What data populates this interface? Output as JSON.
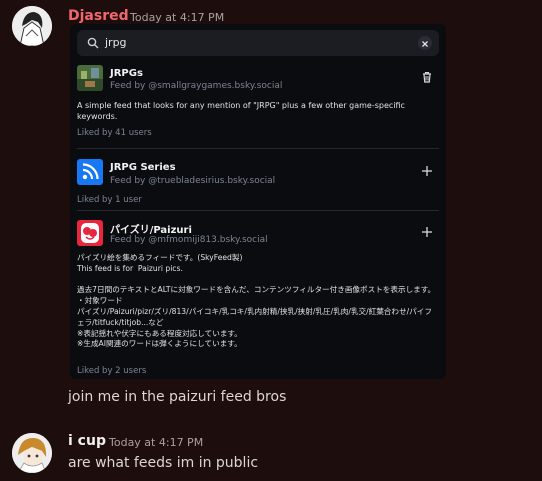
{
  "messages": [
    {
      "username": "Djasred",
      "username_color": "#f0676d",
      "timestamp": "Today at 4:17 PM",
      "embed": {
        "search": {
          "value": "jrpg"
        },
        "feeds": [
          {
            "title": "JRPGs",
            "by": "Feed by @smallgraygames.bsky.social",
            "description": "A simple feed that looks for any mention of \"JRPG\" plus a few other game-specific keywords.",
            "liked": "Liked by 41 users",
            "action_icon": "trash-icon"
          },
          {
            "title": "JRPG Series",
            "by": "Feed by @truebladesirius.bsky.social",
            "description": "",
            "liked": "Liked by 1 user",
            "action_icon": "plus-icon"
          },
          {
            "title": "パイズリ/Paizuri",
            "by": "Feed by @mfmomiji813.bsky.social",
            "description": "パイズリ絵を集めるフィードです。(SkyFeed製)\nThis feed is for  Paizuri pics.\n\n過去7日間のテキストとALTに対象ワードを含んだ、コンテンツフィルター付き画像ポストを表示します。\n・対象ワード\nパイズリ/Paizuri/pizr/ズリ/813/パイコキ/乳コキ/乳内射精/挟乳/挟射/乳圧/乳肉/乳交/紅葉合わせ/パイフェラ/titfuck/titjob...など\n※表記揺れや伏字にもある程度対応しています。\n※生成AI関連のワードは弾くようにしています。",
            "liked": "Liked by 2 users",
            "action_icon": "plus-icon"
          }
        ]
      },
      "text": "join me in the paizuri feed bros"
    },
    {
      "username": "i cup",
      "username_color": "#f2efef",
      "timestamp": "Today at 4:17 PM",
      "text": "are what feeds im in public"
    }
  ]
}
